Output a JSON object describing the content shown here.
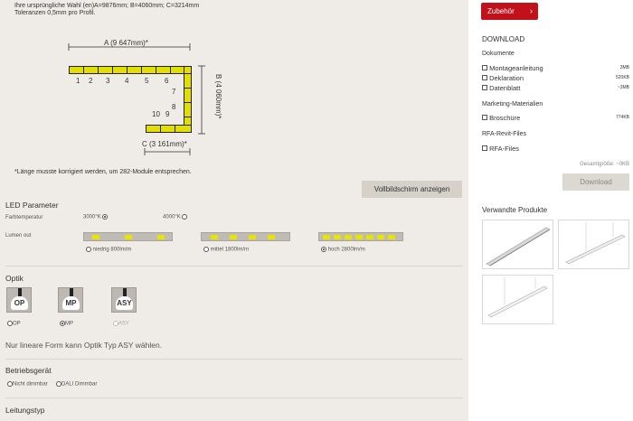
{
  "config_info": {
    "line1": "Ihre ursprüngliche Wahl (en)A=9876mm; B=4060mm; C=3214mm",
    "line2": "Toleranzen 0,5mm pro Profil."
  },
  "diagram": {
    "label_a": "A (9 647mm)*",
    "label_b": "B (4 060mm)*",
    "label_c": "C (3 161mm)*",
    "module_numbers": [
      "1",
      "2",
      "3",
      "4",
      "5",
      "6",
      "7",
      "8",
      "9",
      "10"
    ]
  },
  "note": "*Länge musste korrigiert werden, um 282-Module entsprechen.",
  "fullscreen_button": "Vollbildschirm anzeigen",
  "led": {
    "title": "LED Parameter",
    "color_temp_label": "Farbtemperatur",
    "temp_options": [
      "3000°K",
      "4000°K"
    ],
    "temp_selected": 0,
    "lumen_label": "Lumen out",
    "lumen_options": [
      "niedrig 800lm/m",
      "mittel 1800lm/m",
      "hoch 2800lm/m"
    ],
    "lumen_selected": 2
  },
  "optik": {
    "title": "Optik",
    "options": [
      "OP",
      "MP",
      "ASY"
    ],
    "selected": 1,
    "hint": "Nur lineare Form kann Optik Typ ASY wählen."
  },
  "betriebsgeraet": {
    "title": "Betriebsgerät",
    "options": [
      "Nicht dimmbar",
      "DALI Dimmbar"
    ]
  },
  "leitungstyp": {
    "title": "Leitungstyp"
  },
  "sidebar": {
    "accessory_button": "Zubehör",
    "download_title": "DOWNLOAD",
    "documents_title": "Dokumente",
    "documents": [
      {
        "name": "Montageanleitung",
        "size": "3MB"
      },
      {
        "name": "Deklaration",
        "size": "520KB"
      },
      {
        "name": "Datenblatt",
        "size": "~3MB"
      }
    ],
    "marketing_title": "Marketing-Materialien",
    "marketing": [
      {
        "name": "Broschüre",
        "size": "774KB"
      }
    ],
    "rfa_title": "RFA-Revit-Files",
    "rfa": [
      {
        "name": "RFA-Files",
        "size": ""
      }
    ],
    "total_size": "Gesamtgröße: ~0KB",
    "download_button": "Download",
    "related_title": "Verwandte Produkte"
  },
  "colors": {
    "accent_red": "#c1121c",
    "module_yellow": "#e3dd00",
    "led_yellow": "#e8e400"
  }
}
